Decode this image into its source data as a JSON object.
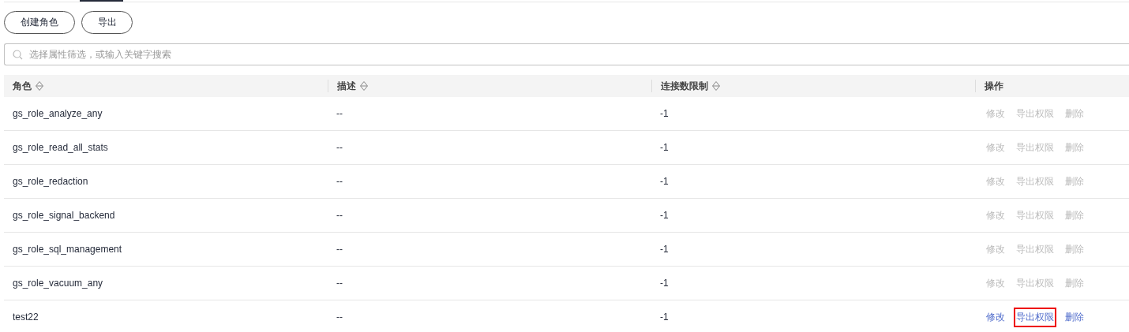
{
  "tab_strip": {
    "active_indicator": true
  },
  "toolbar": {
    "buttons": [
      "创建角色",
      "导出"
    ]
  },
  "search": {
    "placeholder": "选择属性筛选，或输入关键字搜索"
  },
  "table": {
    "columns": [
      {
        "label": "角色",
        "sortable": true
      },
      {
        "label": "描述",
        "sortable": true
      },
      {
        "label": "连接数限制",
        "sortable": true
      },
      {
        "label": "操作",
        "sortable": false
      }
    ],
    "rows": [
      {
        "role": "gs_role_analyze_any",
        "description": "--",
        "limit": "-1",
        "actions": [
          {
            "label": "修改",
            "disabled": true,
            "highlighted": false
          },
          {
            "label": "导出权限",
            "disabled": true,
            "highlighted": false
          },
          {
            "label": "删除",
            "disabled": true,
            "highlighted": false
          }
        ]
      },
      {
        "role": "gs_role_read_all_stats",
        "description": "--",
        "limit": "-1",
        "actions": [
          {
            "label": "修改",
            "disabled": true,
            "highlighted": false
          },
          {
            "label": "导出权限",
            "disabled": true,
            "highlighted": false
          },
          {
            "label": "删除",
            "disabled": true,
            "highlighted": false
          }
        ]
      },
      {
        "role": "gs_role_redaction",
        "description": "--",
        "limit": "-1",
        "actions": [
          {
            "label": "修改",
            "disabled": true,
            "highlighted": false
          },
          {
            "label": "导出权限",
            "disabled": true,
            "highlighted": false
          },
          {
            "label": "删除",
            "disabled": true,
            "highlighted": false
          }
        ]
      },
      {
        "role": "gs_role_signal_backend",
        "description": "--",
        "limit": "-1",
        "actions": [
          {
            "label": "修改",
            "disabled": true,
            "highlighted": false
          },
          {
            "label": "导出权限",
            "disabled": true,
            "highlighted": false
          },
          {
            "label": "删除",
            "disabled": true,
            "highlighted": false
          }
        ]
      },
      {
        "role": "gs_role_sql_management",
        "description": "--",
        "limit": "-1",
        "actions": [
          {
            "label": "修改",
            "disabled": true,
            "highlighted": false
          },
          {
            "label": "导出权限",
            "disabled": true,
            "highlighted": false
          },
          {
            "label": "删除",
            "disabled": true,
            "highlighted": false
          }
        ]
      },
      {
        "role": "gs_role_vacuum_any",
        "description": "--",
        "limit": "-1",
        "actions": [
          {
            "label": "修改",
            "disabled": true,
            "highlighted": false
          },
          {
            "label": "导出权限",
            "disabled": true,
            "highlighted": false
          },
          {
            "label": "删除",
            "disabled": true,
            "highlighted": false
          }
        ]
      },
      {
        "role": "test22",
        "description": "--",
        "limit": "-1",
        "actions": [
          {
            "label": "修改",
            "disabled": false,
            "highlighted": false
          },
          {
            "label": "导出权限",
            "disabled": false,
            "highlighted": true
          },
          {
            "label": "删除",
            "disabled": false,
            "highlighted": false
          }
        ]
      }
    ]
  }
}
